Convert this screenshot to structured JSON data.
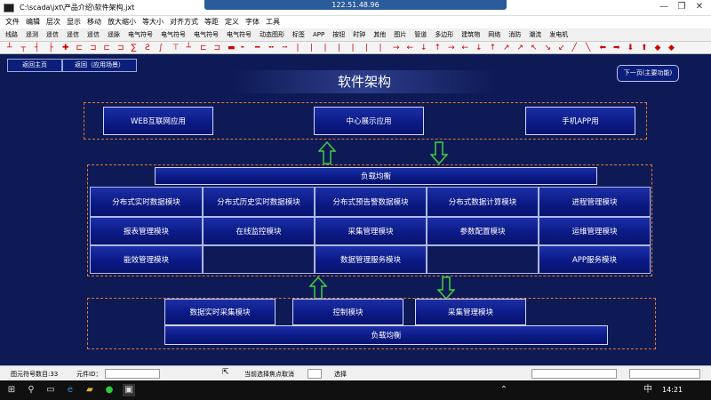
{
  "window": {
    "title": "C:\\scada\\jxt\\产品介绍\\软件架构.jxt",
    "connection": "122.51.48.96",
    "minimize": "—",
    "restore": "❐",
    "close": "✕"
  },
  "menu": [
    "文件",
    "编辑",
    "层次",
    "显示",
    "移动",
    "放大缩小",
    "等大小",
    "对齐方式",
    "等距",
    "定义",
    "字体",
    "工具"
  ],
  "tabs": [
    "线路",
    "遥测",
    "遥信",
    "遥信",
    "遥信",
    "遥脉",
    "电气符号",
    "电气符号",
    "电气符号",
    "电气符号",
    "动态图形",
    "标签",
    "APP",
    "按钮",
    "时钟",
    "其他",
    "图片",
    "管道",
    "多边形",
    "建筑物",
    "网络",
    "消防",
    "潮流",
    "发电机"
  ],
  "nav": {
    "home": "返回主页",
    "scenes": "返回（应用场景）"
  },
  "page_title": "软件架构",
  "next_button": "下一页(主要功能)",
  "top_row": [
    "WEB互联网应用",
    "中心展示应用",
    "手机APP用"
  ],
  "load_balance_top": "负载均衡",
  "modules": [
    [
      "分布式实时数据模块",
      "分布式历史实时数据模块",
      "分布式预告警数据模块",
      "分布式数据计算模块",
      "进程管理模块"
    ],
    [
      "报表管理模块",
      "在线监控模块",
      "采集管理模块",
      "参数配置模块",
      "运维管理模块"
    ],
    [
      "能效管理模块",
      "",
      "数据管理服务模块",
      "",
      "APP服务模块"
    ]
  ],
  "bottom_row": [
    "数据实时采集模块",
    "控制模块",
    "采集管理模块"
  ],
  "load_balance_bottom": "负载均衡",
  "status": {
    "count": "图元符号数目:33",
    "element_id_label": "元件ID：",
    "hint": "当前选择焦点取消",
    "select": "选择"
  },
  "taskbar": {
    "time": "14:21",
    "lang": "中"
  }
}
